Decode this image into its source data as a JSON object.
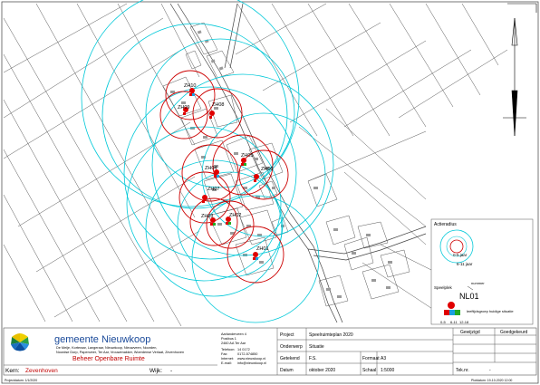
{
  "map": {
    "zones": [
      {
        "id": "ZH10"
      },
      {
        "id": "ZH09"
      },
      {
        "id": "ZH08"
      },
      {
        "id": "ZH05"
      },
      {
        "id": "ZH06"
      },
      {
        "id": "ZH04"
      },
      {
        "id": "ZH07"
      },
      {
        "id": "ZH03"
      },
      {
        "id": "ZH02"
      },
      {
        "id": "ZH01"
      }
    ],
    "colors": {
      "radius_small": "#cc0000",
      "radius_large": "#00c8d8",
      "playground": "#e00000",
      "roads": "#444444",
      "age_0_5": "#e00000",
      "age_6_11": "#22aa22",
      "age_12_18": "#1aa0e0"
    }
  },
  "legend": {
    "title": "Actieradius",
    "small_label": "0-5 jaar",
    "large_label": "6-11 jaar",
    "playground_title": "Speelplek",
    "nummer_label": "nummer",
    "example_id": "NL01",
    "age_group_label": "leeftijdsgroep huidige situatie",
    "age_labels": [
      "0-5",
      "6-11",
      "12-18"
    ]
  },
  "titleblock": {
    "org_name": "gemeente Nieuwkoop",
    "org_places": [
      "De Meije, Korteraar, Langeraar, Nieuwkoop, Nieuwveen, Noorden,",
      "Noordse Dorp, Papenveer, Ter Aar, Vrouwenakker, Woerdense Verlaat, Zevenhoven"
    ],
    "department": "Beheer Openbare Ruimte",
    "address_lines": [
      "Aarlanderveen 4",
      "Postbus 1",
      "2460 AA Ter Aar"
    ],
    "contact_labels": [
      "Telefoon:",
      "Fax:",
      "Internet:",
      "E-mail:"
    ],
    "contact_values": [
      "14 0172",
      "0172-574850",
      "www.nieuwkoop.nl",
      "info@nieuwkoop.nl"
    ],
    "kern_label": "Kern:",
    "kern_value": "Zevenhoven",
    "wijk_label": "Wijk:",
    "wijk_value": "-",
    "project_label": "Project",
    "project_value": "Speelruimteplan 2020",
    "onderwerp_label": "Onderwerp",
    "onderwerp_value": "Situatie",
    "getekend_label": "Getekend",
    "getekend_value": "F.S.",
    "formaat_label": "Formaat",
    "formaat_value": "A3",
    "datum_label": "Datum",
    "datum_value": "oktober 2020",
    "schaal_label": "Schaal",
    "schaal_value": "1:5000",
    "gewijzigd_label": "Gewijzigd",
    "goedgekeurd_label": "Goedgekeurd",
    "teknr_label": "Tek.nr.",
    "teknr_value": "-",
    "footer_left": "Projectdatum: 1/1/2020",
    "footer_right": "Plotdatum: 19-10-2020 12:00"
  }
}
